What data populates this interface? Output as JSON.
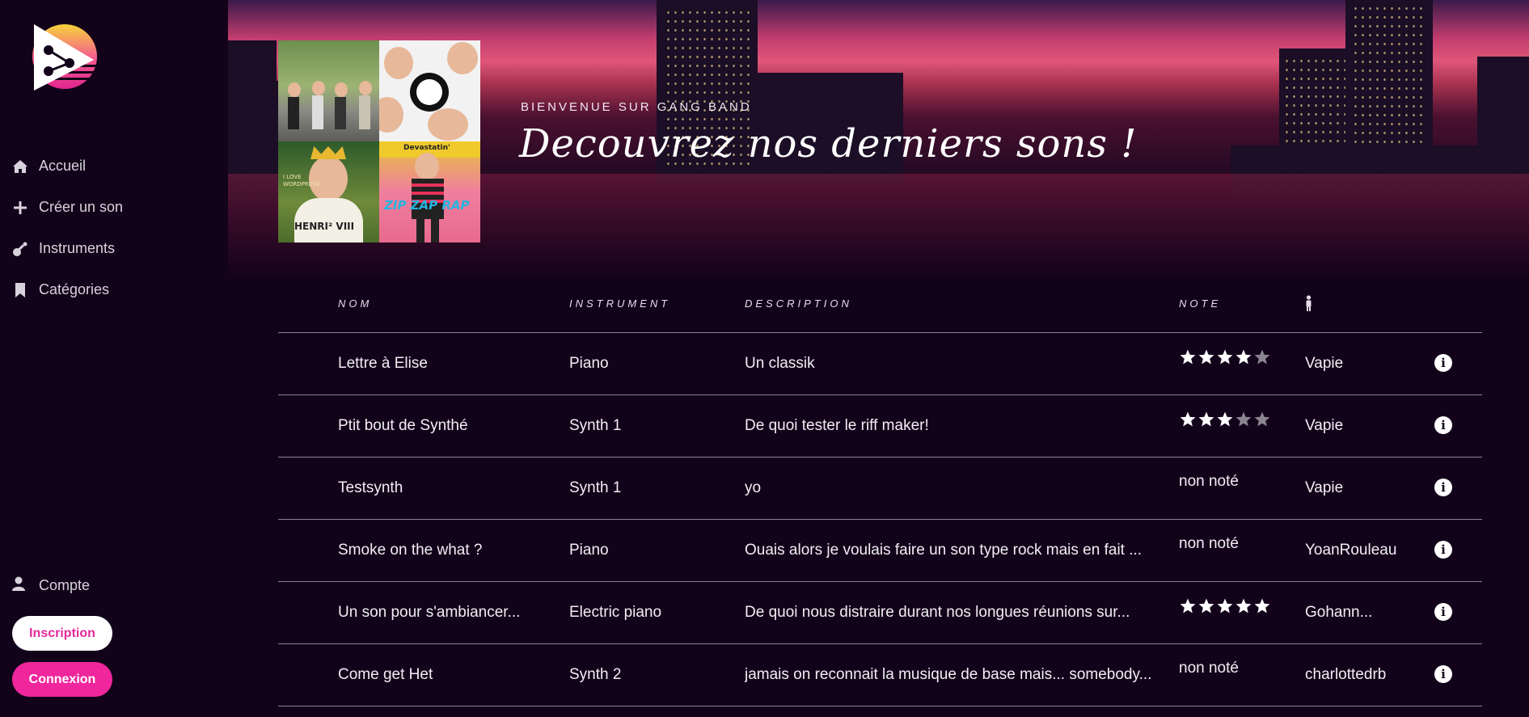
{
  "sidebar": {
    "nav": [
      {
        "label": "Accueil",
        "icon": "home-icon"
      },
      {
        "label": "Créer un son",
        "icon": "plus-icon"
      },
      {
        "label": "Instruments",
        "icon": "guitar-icon"
      },
      {
        "label": "Catégories",
        "icon": "bookmark-icon"
      }
    ],
    "account_label": "Compte",
    "signup_label": "Inscription",
    "login_label": "Connexion"
  },
  "hero": {
    "welcome": "BIENVENUE SUR GANG BAND",
    "headline": "Decouvrez nos derniers sons !",
    "covers": {
      "cover3_text": "I LOVE WORDPRESS",
      "cover3_title": "HENRI² VIII",
      "cover4_top": "Devastatin'",
      "cover4_title": "ZIP ZAP RAP"
    }
  },
  "table": {
    "headers": {
      "nom": "NOM",
      "instrument": "INSTRUMENT",
      "description": "DESCRIPTION",
      "note": "NOTE",
      "user_icon": "person-icon"
    },
    "rows": [
      {
        "nom": "Lettre à Elise",
        "instrument": "Piano",
        "description": "Un classik",
        "rating": 4,
        "note_text": "",
        "user": "Vapie"
      },
      {
        "nom": "Ptit bout de Synthé",
        "instrument": "Synth 1",
        "description": "De quoi tester le riff maker!",
        "rating": 3,
        "note_text": "",
        "user": "Vapie"
      },
      {
        "nom": "Testsynth",
        "instrument": "Synth 1",
        "description": "yo",
        "rating": null,
        "note_text": "non noté",
        "user": "Vapie"
      },
      {
        "nom": "Smoke on the what ?",
        "instrument": "Piano",
        "description": "Ouais alors je voulais faire un son type rock mais en fait ...",
        "rating": null,
        "note_text": "non noté",
        "user": "YoanRouleau"
      },
      {
        "nom": "Un son pour s'ambiancer...",
        "instrument": "Electric piano",
        "description": "De quoi nous distraire durant nos longues réunions sur...",
        "rating": 5,
        "note_text": "",
        "user": "Gohann..."
      },
      {
        "nom": "Come get Het",
        "instrument": "Synth 2",
        "description": "jamais on reconnait la musique de base mais... somebody...",
        "rating": null,
        "note_text": "non noté",
        "user": "charlottedrb"
      }
    ],
    "info_icon": "info-icon"
  },
  "colors": {
    "accent": "#f0269c",
    "background": "#13031a"
  }
}
